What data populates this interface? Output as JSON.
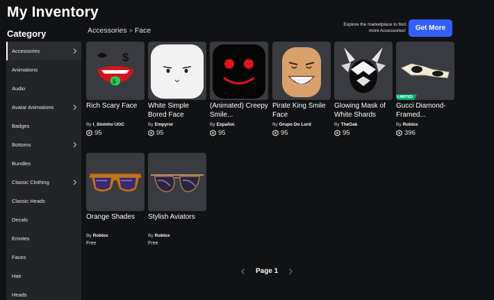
{
  "header": {
    "title": "My Inventory"
  },
  "sidebar": {
    "title": "Category",
    "items": [
      {
        "label": "Accessories",
        "has_arrow": true,
        "active": true
      },
      {
        "label": "Animations",
        "has_arrow": false
      },
      {
        "label": "Audio",
        "has_arrow": false
      },
      {
        "label": "Avatar Animations",
        "has_arrow": true
      },
      {
        "label": "Badges",
        "has_arrow": false
      },
      {
        "label": "Bottoms",
        "has_arrow": true
      },
      {
        "label": "Bundles",
        "has_arrow": false
      },
      {
        "label": "Classic Clothing",
        "has_arrow": true
      },
      {
        "label": "Classic Heads",
        "has_arrow": false
      },
      {
        "label": "Decals",
        "has_arrow": false
      },
      {
        "label": "Emotes",
        "has_arrow": false
      },
      {
        "label": "Faces",
        "has_arrow": false
      },
      {
        "label": "Hair",
        "has_arrow": false
      },
      {
        "label": "Heads",
        "has_arrow": false
      }
    ]
  },
  "breadcrumb": {
    "parent": "Accessories",
    "separator": ">",
    "current": "Face"
  },
  "promo": {
    "text": "Explore the marketplace to find more Accessories!",
    "button_label": "Get More",
    "button_color": "#335fff"
  },
  "items": [
    {
      "name": "Rich Scary Face",
      "by_label": "By",
      "creator": "I_Sininho UGC",
      "price": "95",
      "icon": "rich-scary-face-thumbnail"
    },
    {
      "name": "White Simple Bored Face",
      "by_label": "By",
      "creator": "Empyror",
      "price": "95",
      "icon": "white-bored-face-thumbnail"
    },
    {
      "name": "(Animated) Creepy Smile...",
      "by_label": "By",
      "creator": "Español.",
      "price": "95",
      "icon": "creepy-smile-thumbnail"
    },
    {
      "name": "Pirate King Smile Face",
      "by_label": "By",
      "creator": "Grupo Do Lord",
      "price": "95",
      "icon": "pirate-king-smile-thumbnail"
    },
    {
      "name": "Glowing Mask of White Shards",
      "by_label": "By",
      "creator": "TheOak",
      "price": "95",
      "icon": "glowing-mask-thumbnail"
    },
    {
      "name": "Gucci Diamond-Framed...",
      "by_label": "By",
      "creator": "Roblox",
      "price": "396",
      "badge": "LIMITED",
      "icon": "gucci-sunglasses-thumbnail"
    },
    {
      "name": "Orange Shades",
      "by_label": "By",
      "creator": "Roblox",
      "price": "Free",
      "icon": "orange-shades-thumbnail"
    },
    {
      "name": "Stylish Aviators",
      "by_label": "By",
      "creator": "Roblox",
      "price": "Free",
      "icon": "stylish-aviators-thumbnail"
    }
  ],
  "pagination": {
    "label": "Page 1",
    "prev_icon": "chevron-left-icon",
    "next_icon": "chevron-right-icon"
  },
  "colors": {
    "background": "#111214",
    "sidebar": "#232428",
    "card": "#3a3b40",
    "limited_badge": "#00b06f"
  }
}
